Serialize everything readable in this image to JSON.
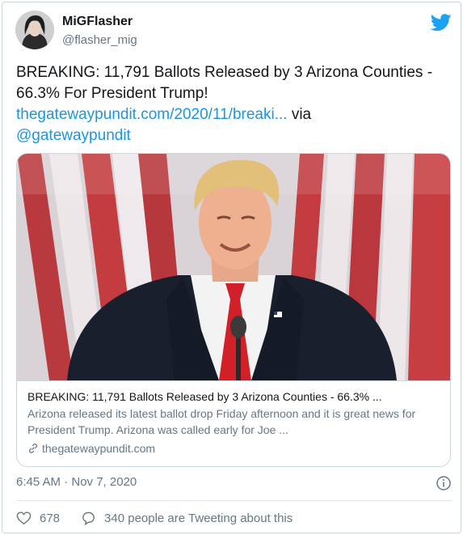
{
  "author": {
    "display_name": "MiGFlasher",
    "handle": "@flasher_mig"
  },
  "tweet": {
    "text": "BREAKING: 11,791 Ballots Released by 3 Arizona Counties - 66.3% For President Trump!",
    "link": "thegatewaypundit.com/2020/11/breaki...",
    "via": "via",
    "mention": "@gatewaypundit"
  },
  "card": {
    "title": "BREAKING: 11,791 Ballots Released by 3 Arizona Counties - 66.3% ...",
    "description": "Arizona released its latest ballot drop Friday afternoon and it is great news for President Trump. Arizona was called early for Joe ...",
    "domain": "thegatewaypundit.com"
  },
  "meta": {
    "timestamp": "6:45 AM · Nov 7, 2020",
    "likes": "678",
    "tweeting": "340 people are Tweeting about this"
  },
  "icons": {
    "brand": "twitter-bird-icon",
    "info": "info-icon",
    "like": "heart-icon",
    "reply": "speech-bubble-icon",
    "link": "chain-link-icon"
  },
  "colors": {
    "link": "#1b95e0",
    "secondary_text": "#657786",
    "border": "#ccd6dd"
  }
}
